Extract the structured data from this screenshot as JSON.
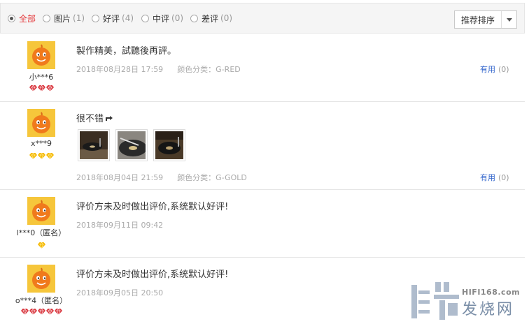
{
  "filters": [
    {
      "label": "全部",
      "count": "",
      "checked": true
    },
    {
      "label": "图片",
      "count": "(1)",
      "checked": false
    },
    {
      "label": "好评",
      "count": "(4)",
      "checked": false
    },
    {
      "label": "中评",
      "count": "(0)",
      "checked": false
    },
    {
      "label": "差评",
      "count": "(0)",
      "checked": false
    }
  ],
  "sort_label": "推荐排序",
  "reviews": [
    {
      "username": "小***6",
      "badge": "red-diamond",
      "badge_count": 3,
      "content": "製作精美，試聽後再評。",
      "date": "2018年08月28日 17:59",
      "spec": "颜色分类：G-RED",
      "useful_label": "有用",
      "useful_count": "(0)"
    },
    {
      "username": "x***9",
      "badge": "gold-diamond",
      "badge_count": 3,
      "content": "很不错",
      "emoji": "pointing-hand-icon",
      "photos": [
        "turntable-photo-1",
        "turntable-photo-2",
        "turntable-photo-3"
      ],
      "date": "2018年08月04日 21:59",
      "spec": "颜色分类：G-GOLD",
      "useful_label": "有用",
      "useful_count": "(0)"
    },
    {
      "username": "l***0（匿名）",
      "badge": "gold-diamond",
      "badge_count": 1,
      "content": "评价方未及时做出评价,系统默认好评!",
      "date": "2018年09月11日 09:42"
    },
    {
      "username": "o***4（匿名）",
      "badge": "red-diamond",
      "badge_count": 5,
      "content": "评价方未及时做出评价,系统默认好评!",
      "date": "2018年09月05日 20:50"
    }
  ],
  "watermark": {
    "site": "HIFI168.com",
    "text": "发烧网"
  },
  "colors": {
    "active": "#e4393c",
    "link": "#3366cc",
    "gold": "#f5b800",
    "red": "#d9363e"
  }
}
